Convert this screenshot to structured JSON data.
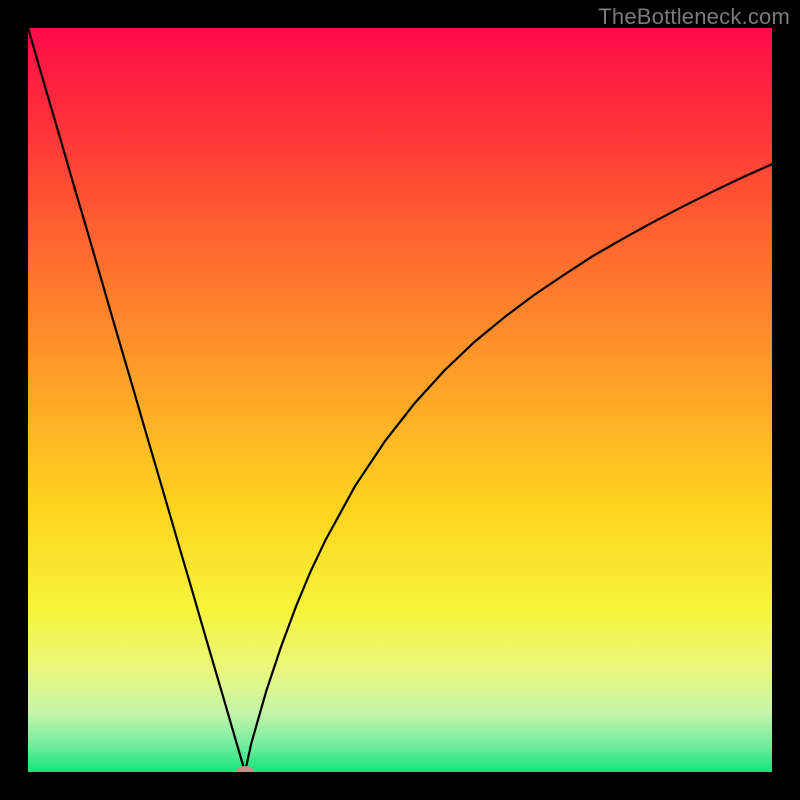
{
  "watermark": {
    "text": "TheBottleneck.com"
  },
  "chart_data": {
    "type": "line",
    "title": "",
    "xlabel": "",
    "ylabel": "",
    "xlim": [
      0,
      100
    ],
    "ylim": [
      0,
      100
    ],
    "gradient_stops": [
      {
        "pct": 0,
        "color": "#ff0b4a"
      },
      {
        "pct": 12,
        "color": "#ff2f3a"
      },
      {
        "pct": 30,
        "color": "#ff6a2f"
      },
      {
        "pct": 48,
        "color": "#ffa328"
      },
      {
        "pct": 64,
        "color": "#ffd21f"
      },
      {
        "pct": 78,
        "color": "#f7f43a"
      },
      {
        "pct": 86,
        "color": "#eaf67b"
      },
      {
        "pct": 92,
        "color": "#c6f5a9"
      },
      {
        "pct": 96,
        "color": "#7aeea0"
      },
      {
        "pct": 100,
        "color": "#13e578"
      }
    ],
    "series": [
      {
        "name": "left-branch",
        "x": [
          0.0,
          2.0,
          4.0,
          6.0,
          8.0,
          10.0,
          12.0,
          14.0,
          16.0,
          18.0,
          20.0,
          22.0,
          24.0,
          26.0,
          28.0,
          29.17
        ],
        "values": [
          100.0,
          93.1,
          86.3,
          79.4,
          72.6,
          65.7,
          58.8,
          52.0,
          45.1,
          38.3,
          31.4,
          24.6,
          17.7,
          10.9,
          4.0,
          0.0
        ]
      },
      {
        "name": "right-branch",
        "x": [
          29.17,
          30.0,
          32.0,
          34.0,
          36.0,
          38.0,
          40.0,
          44.0,
          48.0,
          52.0,
          56.0,
          60.0,
          64.0,
          68.0,
          72.0,
          76.0,
          80.0,
          84.0,
          88.0,
          92.0,
          96.0,
          100.0
        ],
        "values": [
          0.0,
          3.8,
          10.8,
          16.8,
          22.2,
          27.0,
          31.2,
          38.5,
          44.5,
          49.6,
          54.0,
          57.8,
          61.1,
          64.1,
          66.8,
          69.4,
          71.7,
          73.9,
          76.0,
          78.0,
          79.9,
          81.7
        ]
      }
    ],
    "markers": [
      {
        "name": "vertex-marker",
        "x": 29.17,
        "y": 0.0,
        "color": "#c69288"
      }
    ],
    "legend": null,
    "grid": false
  }
}
